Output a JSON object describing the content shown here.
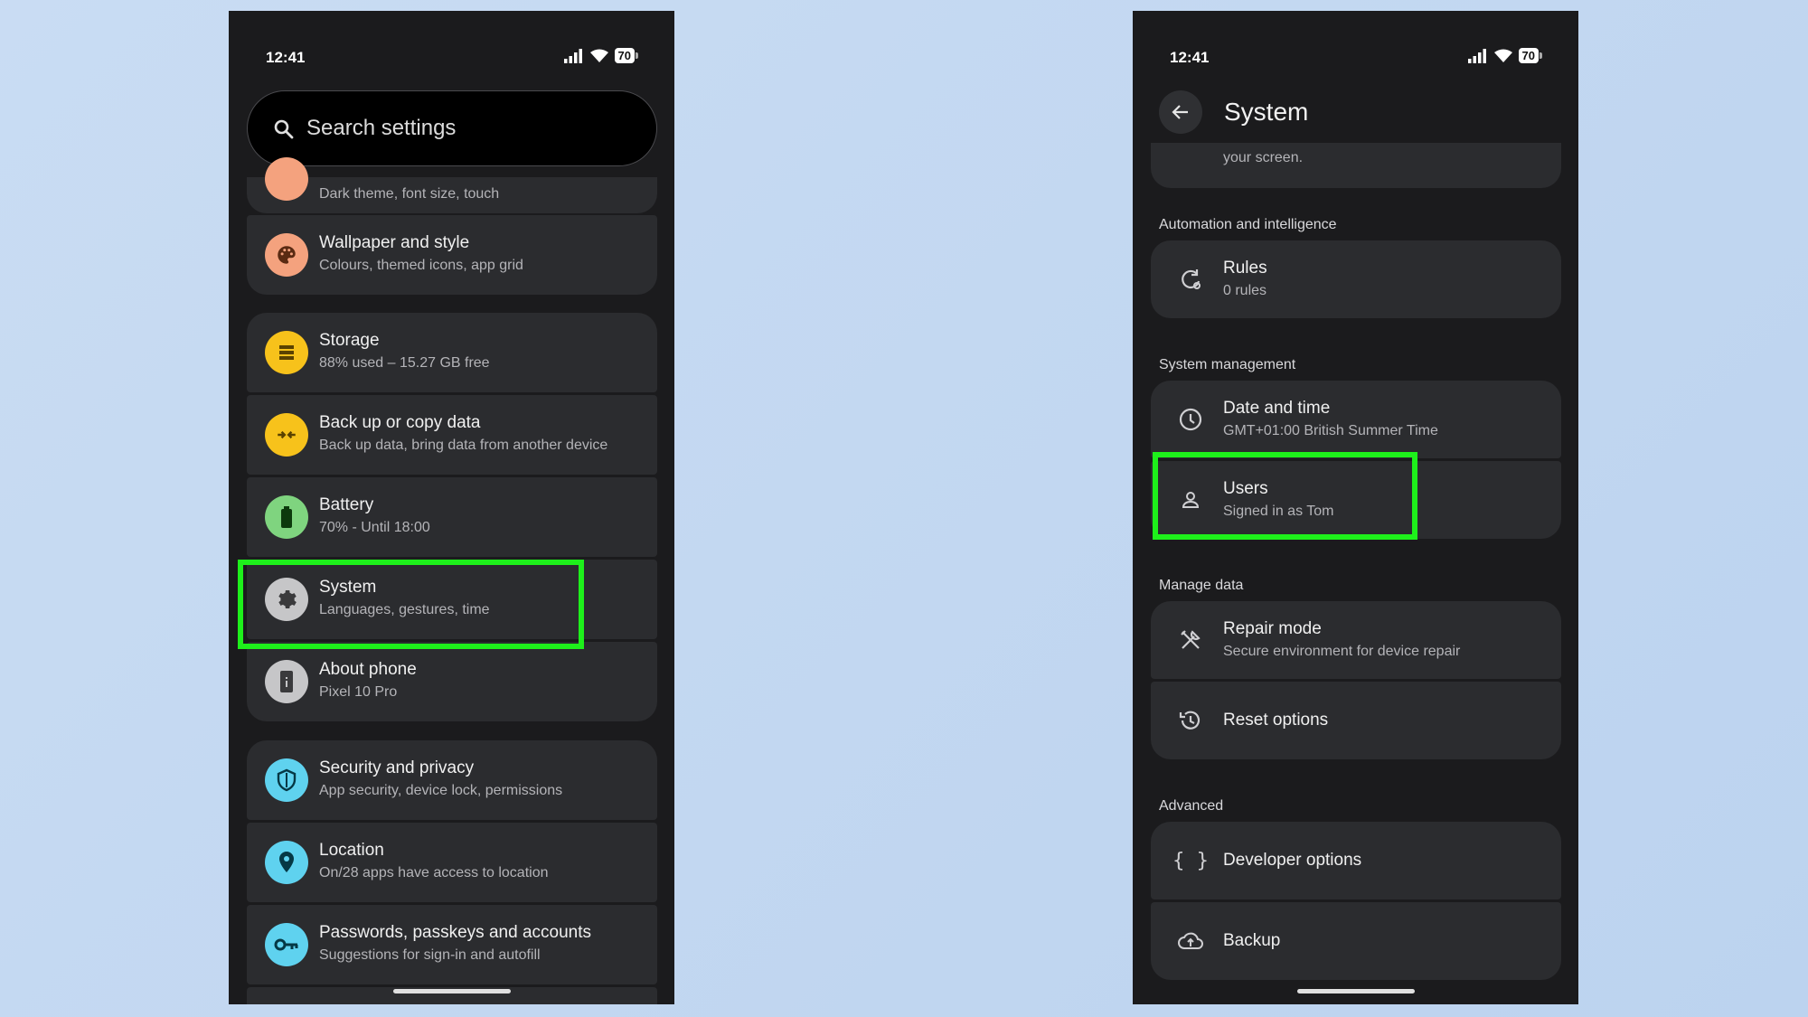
{
  "left": {
    "status_time": "12:41",
    "battery": "70",
    "search_placeholder": "Search settings",
    "items": [
      {
        "subtitle": "Dark theme, font size, touch"
      },
      {
        "title": "Wallpaper and style",
        "subtitle": "Colours, themed icons, app grid"
      },
      {
        "title": "Storage",
        "subtitle": "88% used – 15.27 GB free"
      },
      {
        "title": "Back up or copy data",
        "subtitle": "Back up data, bring data from another device"
      },
      {
        "title": "Battery",
        "subtitle": "70% - Until 18:00"
      },
      {
        "title": "System",
        "subtitle": "Languages, gestures, time"
      },
      {
        "title": "About phone",
        "subtitle": "Pixel 10 Pro"
      },
      {
        "title": "Security and privacy",
        "subtitle": "App security, device lock, permissions"
      },
      {
        "title": "Location",
        "subtitle": "On/28 apps have access to location"
      },
      {
        "title": "Passwords, passkeys and accounts",
        "subtitle": "Suggestions for sign-in and autofill"
      }
    ]
  },
  "right": {
    "status_time": "12:41",
    "battery": "70",
    "header_title": "System",
    "partial_text": "your screen.",
    "sections": {
      "automation": "Automation and intelligence",
      "management": "System management",
      "manage_data": "Manage data",
      "advanced": "Advanced"
    },
    "items": {
      "rules": {
        "title": "Rules",
        "subtitle": "0 rules"
      },
      "date_time": {
        "title": "Date and time",
        "subtitle": "GMT+01:00 British Summer Time"
      },
      "users": {
        "title": "Users",
        "subtitle": "Signed in as Tom"
      },
      "repair": {
        "title": "Repair mode",
        "subtitle": "Secure environment for device repair"
      },
      "reset": {
        "title": "Reset options"
      },
      "developer": {
        "title": "Developer options"
      },
      "backup": {
        "title": "Backup"
      }
    }
  },
  "colors": {
    "highlight": "#1ef01b",
    "card_bg": "#2b2c2f",
    "screen_bg": "#1b1b1d",
    "wallpaper_icon": "#f4a27e",
    "storage_icon": "#f7c21b",
    "battery_icon": "#7fd47f",
    "system_icon": "#c6c6c8",
    "security_icon": "#5fd2ef"
  }
}
